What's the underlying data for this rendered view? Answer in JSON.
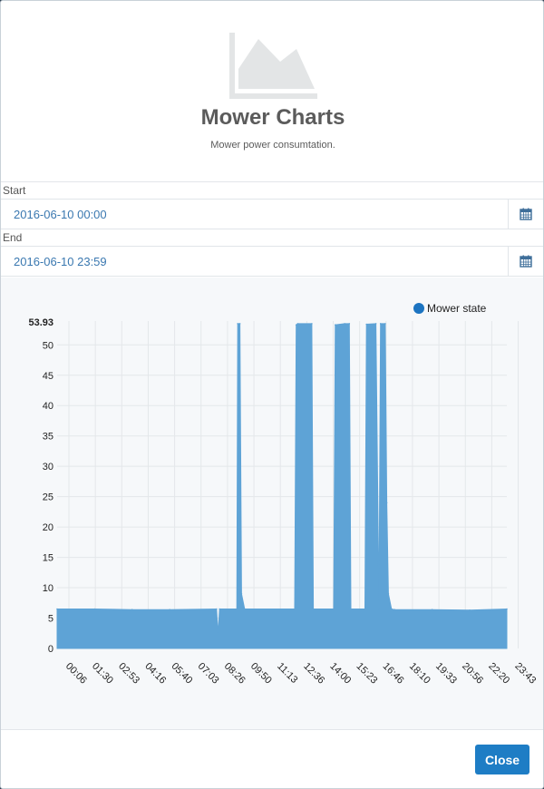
{
  "modal": {
    "title": "Mower Charts",
    "subtitle": "Mower power consumtation.",
    "icon": "area-chart-icon"
  },
  "form": {
    "start_label": "Start",
    "start_value": "2016-06-10 00:00",
    "end_label": "End",
    "end_value": "2016-06-10 23:59",
    "calendar_icon": "calendar-icon"
  },
  "footer": {
    "close_label": "Close"
  },
  "colors": {
    "series": "#5ea3d6",
    "legend_dot": "#1c74c1",
    "button": "#1e7dc5"
  },
  "chart_data": {
    "type": "area",
    "xlabel": "",
    "ylabel": "",
    "ylim": [
      0,
      53.93
    ],
    "ymax_label": "53.93",
    "yticks": [
      0,
      5,
      10,
      15,
      20,
      25,
      30,
      35,
      40,
      45,
      50
    ],
    "grid": true,
    "legend_position": "top-right",
    "x_tick_labels": [
      "00:06",
      "01:30",
      "02:53",
      "04:16",
      "05:40",
      "07:03",
      "08:26",
      "09:50",
      "11:13",
      "12:36",
      "14:00",
      "15:23",
      "16:46",
      "18:10",
      "19:33",
      "20:56",
      "22:20",
      "23:43"
    ],
    "series": [
      {
        "name": "Mower state",
        "x": [
          "00:00",
          "02:00",
          "04:00",
          "06:00",
          "08:30",
          "08:35",
          "08:40",
          "09:35",
          "09:38",
          "09:45",
          "09:50",
          "10:00",
          "12:40",
          "12:45",
          "12:50",
          "13:35",
          "13:40",
          "14:45",
          "14:50",
          "15:20",
          "15:35",
          "15:40",
          "16:25",
          "16:30",
          "17:00",
          "17:10",
          "17:15",
          "17:30",
          "17:35",
          "17:40",
          "17:50",
          "18:00",
          "20:00",
          "22:00",
          "23:59"
        ],
        "values": [
          6.5,
          6.5,
          6.4,
          6.4,
          6.5,
          2.5,
          6.5,
          6.5,
          53.5,
          53.5,
          9,
          6.5,
          6.5,
          53.3,
          53.5,
          53.5,
          6.5,
          6.5,
          53.3,
          53.5,
          53.5,
          6.5,
          6.5,
          53.4,
          53.5,
          6.5,
          53.5,
          53.5,
          24,
          9,
          6.5,
          6.4,
          6.4,
          6.3,
          6.5
        ]
      }
    ]
  }
}
